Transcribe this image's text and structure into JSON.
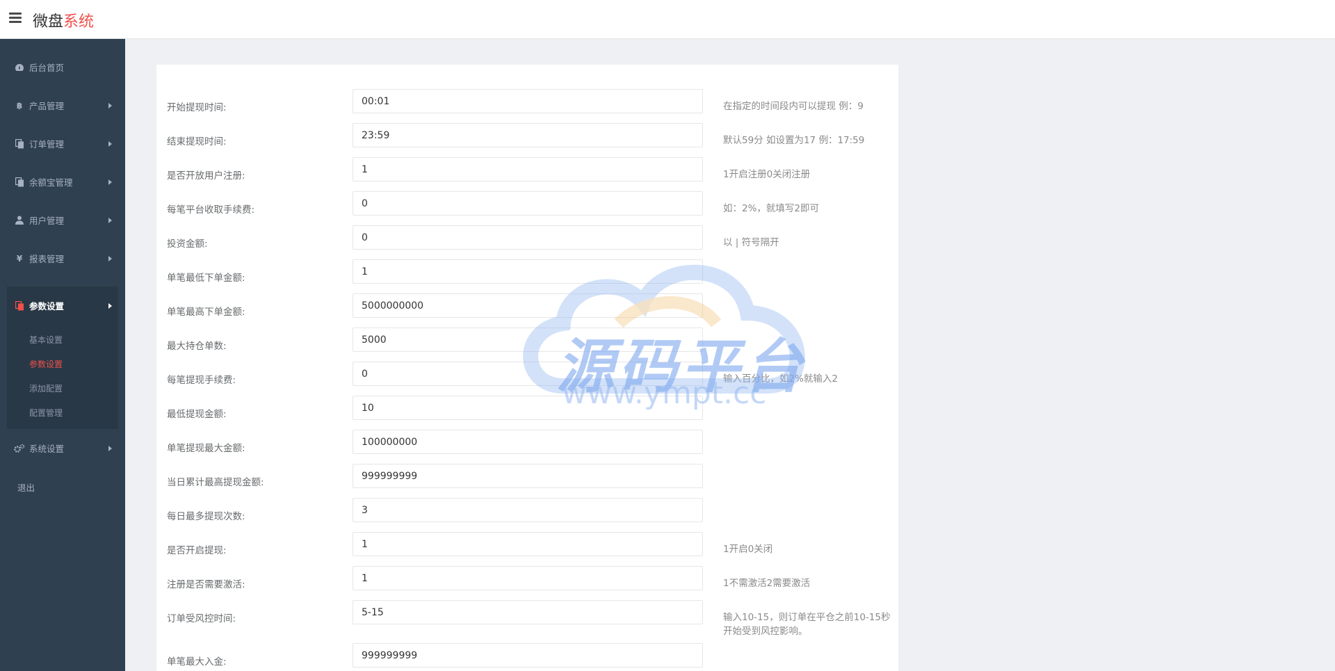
{
  "header": {
    "brand_main": "微盘",
    "brand_accent": "系统"
  },
  "sidebar": {
    "items": [
      {
        "label": "后台首页",
        "icon": "dashboard-icon"
      },
      {
        "label": "产品管理",
        "icon": "bitcoin-icon"
      },
      {
        "label": "订单管理",
        "icon": "copy-icon"
      },
      {
        "label": "余额宝管理",
        "icon": "copy-icon"
      },
      {
        "label": "用户管理",
        "icon": "user-icon"
      },
      {
        "label": "报表管理",
        "icon": "yen-icon"
      }
    ],
    "active": {
      "label": "参数设置",
      "icon": "copy-icon",
      "sub_items": [
        "基本设置",
        "参数设置",
        "添加配置",
        "配置管理"
      ]
    },
    "system": {
      "label": "系统设置",
      "icon": "gears-icon"
    },
    "logout": "退出"
  },
  "form": {
    "rows": [
      {
        "label": "开始提现时间:",
        "value": "00:01",
        "help": "在指定的时间段内可以提现 例：9"
      },
      {
        "label": "结束提现时间:",
        "value": "23:59",
        "help": "默认59分 如设置为17 例：17:59"
      },
      {
        "label": "是否开放用户注册:",
        "value": "1",
        "help": "1开启注册0关闭注册"
      },
      {
        "label": "每笔平台收取手续费:",
        "value": "0",
        "help": "如：2%，就填写2即可"
      },
      {
        "label": "投资金额:",
        "value": "0",
        "help": "以 | 符号隔开"
      },
      {
        "label": "单笔最低下单金额:",
        "value": "1",
        "help": ""
      },
      {
        "label": "单笔最高下单金额:",
        "value": "5000000000",
        "help": ""
      },
      {
        "label": "最大持仓单数:",
        "value": "5000",
        "help": ""
      },
      {
        "label": "每笔提现手续费:",
        "value": "0",
        "help": "输入百分比，如2%就输入2"
      },
      {
        "label": "最低提现金额:",
        "value": "10",
        "help": ""
      },
      {
        "label": "单笔提现最大金额:",
        "value": "100000000",
        "help": ""
      },
      {
        "label": "当日累计最高提现金额:",
        "value": "999999999",
        "help": ""
      },
      {
        "label": "每日最多提现次数:",
        "value": "3",
        "help": ""
      },
      {
        "label": "是否开启提现:",
        "value": "1",
        "help": "1开启0关闭"
      },
      {
        "label": "注册是否需要激活:",
        "value": "1",
        "help": "1不需激活2需要激活"
      },
      {
        "label": "订单受风控时间:",
        "value": "5-15",
        "help": "输入10-15，则订单在平仓之前10-15秒开始受到风控影响。"
      },
      {
        "label": "单笔最大入金:",
        "value": "999999999",
        "help": ""
      }
    ]
  },
  "watermark": {
    "text": "源码平台",
    "url": "www.ympt.cc"
  },
  "colors": {
    "sidebar_bg": "#2f4050",
    "accent": "#f0504a",
    "content_bg": "#eff0f4"
  }
}
